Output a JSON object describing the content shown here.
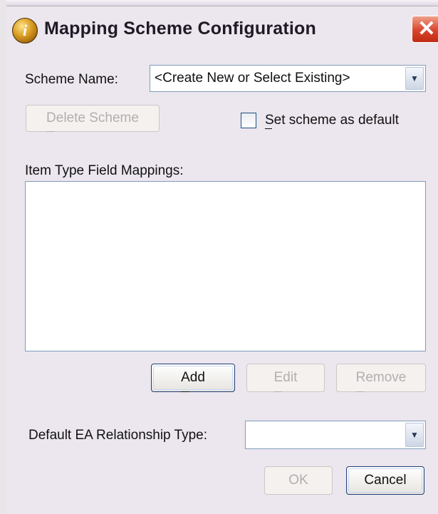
{
  "window": {
    "title": "Mapping Scheme Configuration",
    "title_icon": "info-icon",
    "title_icon_glyph": "i",
    "close_glyph": "✕"
  },
  "scheme": {
    "label": "Scheme Name:",
    "value": "<Create New or Select Existing>",
    "dropdown_glyph": "▼"
  },
  "delete_button": "Delete Scheme",
  "default_checkbox": {
    "label": "Set scheme as default",
    "checked": false
  },
  "mappings": {
    "label": "Item Type Field Mappings:",
    "items": []
  },
  "mapping_buttons": {
    "add": "Add",
    "edit": "Edit",
    "remove": "Remove"
  },
  "relationship": {
    "label": "Default EA Relationship Type:",
    "value": "",
    "dropdown_glyph": "▼"
  },
  "footer": {
    "ok": "OK",
    "cancel": "Cancel"
  },
  "colors": {
    "dialog_bg": "#ece6ee",
    "close_red": "#d9442a",
    "focus_border": "#1f3f76",
    "field_border": "#7f9db9"
  }
}
